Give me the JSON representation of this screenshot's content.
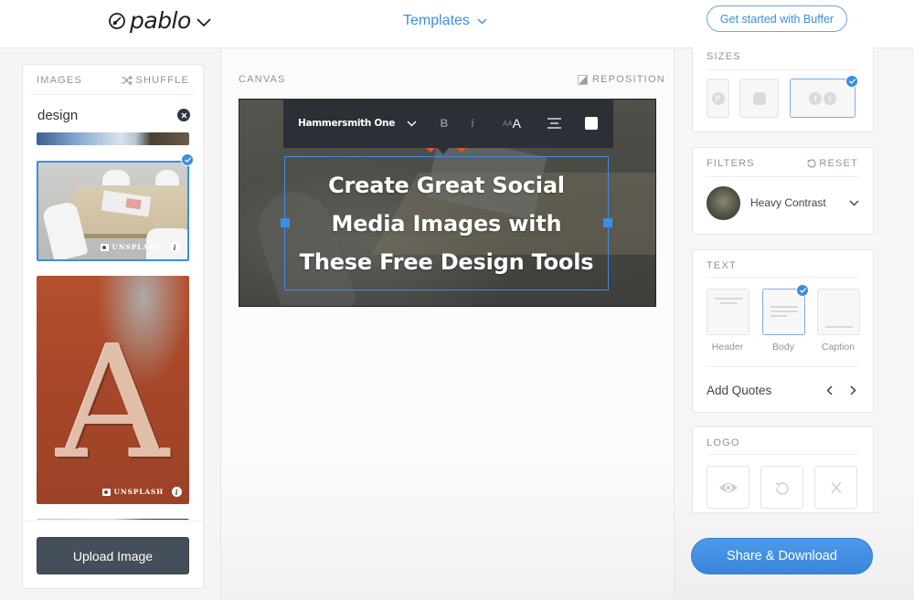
{
  "header": {
    "brand": "pablo",
    "templates_label": "Templates",
    "cta_label": "Get started with Buffer"
  },
  "images_panel": {
    "title": "IMAGES",
    "shuffle_label": "SHUFFLE",
    "search": {
      "value": "design",
      "placeholder": ""
    },
    "thumbnails": [
      {
        "description": "sky and building",
        "selected": false,
        "credit": ""
      },
      {
        "description": "desk with white chairs",
        "selected": true,
        "credit": "UNSPLASH"
      },
      {
        "description": "rusty letter A",
        "selected": false,
        "credit": "UNSPLASH",
        "letter": "A"
      },
      {
        "description": "partial thumbnail",
        "selected": false,
        "credit": ""
      }
    ],
    "info_glyph": "i",
    "upload_label": "Upload Image"
  },
  "canvas": {
    "title": "CANVAS",
    "reposition_label": "REPOSITION",
    "toolbar": {
      "font": "Hammersmith One",
      "bold": "B",
      "italic": "i",
      "size_small": "AA",
      "size_large": "A",
      "text_color": "#ffffff"
    },
    "headline_lines": [
      "Create Great Social",
      "Media Images with",
      "These Free Design Tools"
    ]
  },
  "sizes_panel": {
    "title": "SIZES",
    "options": [
      {
        "name": "pinterest",
        "glyph": "P",
        "selected": false
      },
      {
        "name": "instagram",
        "glyph": "",
        "selected": false
      },
      {
        "name": "facebook-twitter",
        "glyphs": [
          "f",
          "t"
        ],
        "selected": true
      }
    ]
  },
  "filters_panel": {
    "title": "FILTERS",
    "reset_label": "RESET",
    "selected_filter": "Heavy Contrast"
  },
  "text_panel": {
    "title": "TEXT",
    "styles": [
      {
        "label": "Header",
        "selected": false
      },
      {
        "label": "Body",
        "selected": true
      },
      {
        "label": "Caption",
        "selected": false
      }
    ],
    "quotes_label": "Add Quotes"
  },
  "logo_panel": {
    "title": "LOGO",
    "actions": [
      "show-logo",
      "replace-logo",
      "remove-logo"
    ]
  },
  "share_label": "Share & Download",
  "colors": {
    "accent": "#3a8ee6",
    "toolbar_bg": "#2b2f36",
    "upload_bg": "#454f59",
    "toolbar_marker": "#e0552b"
  }
}
